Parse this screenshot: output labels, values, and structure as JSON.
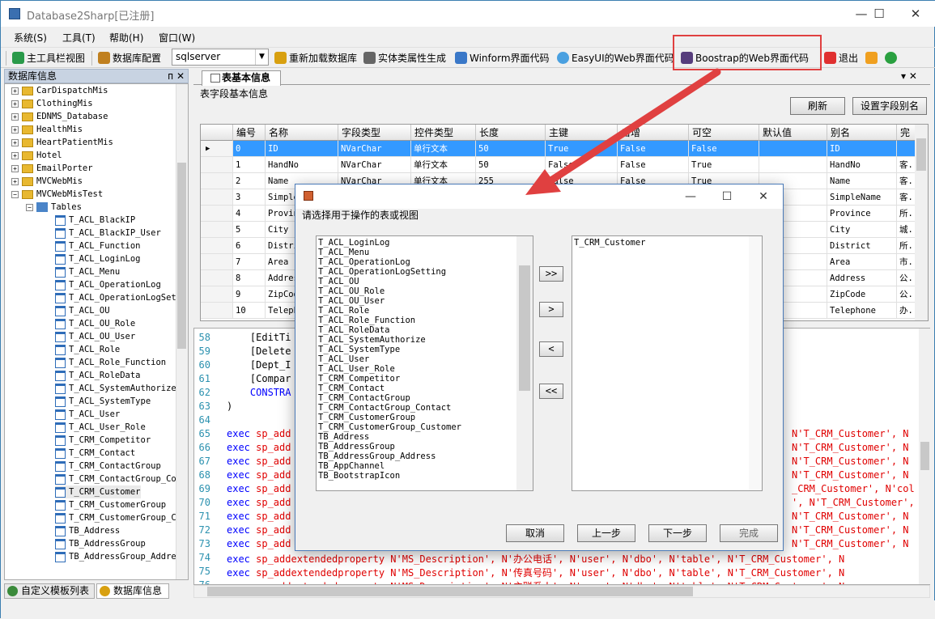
{
  "window": {
    "title": "Database2Sharp[已注册]",
    "min": "—",
    "max": "☐",
    "close": "✕"
  },
  "menu": [
    "系统(S)",
    "工具(T)",
    "帮助(H)",
    "窗口(W)"
  ],
  "toolbar": {
    "main_toolbar": "主工具栏视图",
    "db_config": "数据库配置",
    "db_type": "sqlserver",
    "reload": "重新加载数据库",
    "entity_gen": "实体类属性生成",
    "winform": "Winform界面代码",
    "easyui": "EasyUI的Web界面代码",
    "bootstrap": "Boostrap的Web界面代码",
    "exit": "退出"
  },
  "left_panel": {
    "title": "数据库信息",
    "pin": "ᴨ",
    "close": "✕",
    "databases": [
      "CarDispatchMis",
      "ClothingMis",
      "EDNMS_Database",
      "HealthMis",
      "HeartPatientMis",
      "Hotel",
      "EmailPorter",
      "MVCWebMis",
      "MVCWebMisTest"
    ],
    "tables_node": "Tables",
    "tables": [
      "T_ACL_BlackIP",
      "T_ACL_BlackIP_User",
      "T_ACL_Function",
      "T_ACL_LoginLog",
      "T_ACL_Menu",
      "T_ACL_OperationLog",
      "T_ACL_OperationLogSet",
      "T_ACL_OU",
      "T_ACL_OU_Role",
      "T_ACL_OU_User",
      "T_ACL_Role",
      "T_ACL_Role_Function",
      "T_ACL_RoleData",
      "T_ACL_SystemAuthorize",
      "T_ACL_SystemType",
      "T_ACL_User",
      "T_ACL_User_Role",
      "T_CRM_Competitor",
      "T_CRM_Contact",
      "T_CRM_ContactGroup",
      "T_CRM_ContactGroup_Co",
      "T_CRM_Customer",
      "T_CRM_CustomerGroup",
      "T_CRM_CustomerGroup_C",
      "TB_Address",
      "TB_AddressGroup",
      "TB_AddressGroup_Addre"
    ],
    "tabs": [
      "自定义模板列表",
      "数据库信息"
    ]
  },
  "doc_tab": {
    "title": "表基本信息",
    "controls": "▾ ✕"
  },
  "fields_panel": {
    "label": "表字段基本信息",
    "refresh": "刷新",
    "set_alias": "设置字段别名",
    "columns": [
      "编号",
      "名称",
      "字段类型",
      "控件类型",
      "长度",
      "主键",
      "自增",
      "可空",
      "默认值",
      "别名",
      "完"
    ],
    "rows": [
      [
        "0",
        "ID",
        "NVarChar",
        "单行文本",
        "50",
        "True",
        "False",
        "False",
        "",
        "ID",
        ""
      ],
      [
        "1",
        "HandNo",
        "NVarChar",
        "单行文本",
        "50",
        "False",
        "False",
        "True",
        "",
        "HandNo",
        "客."
      ],
      [
        "2",
        "Name",
        "NVarChar",
        "单行文本",
        "255",
        "False",
        "False",
        "True",
        "",
        "Name",
        "客."
      ],
      [
        "3",
        "SimpleName",
        "",
        "",
        "",
        "",
        "",
        "",
        "",
        "SimpleName",
        "客."
      ],
      [
        "4",
        "Province",
        "",
        "",
        "",
        "",
        "",
        "",
        "",
        "Province",
        "所."
      ],
      [
        "5",
        "City",
        "",
        "",
        "",
        "",
        "",
        "",
        "",
        "City",
        "城."
      ],
      [
        "6",
        "District",
        "",
        "",
        "",
        "",
        "",
        "",
        "",
        "District",
        "所."
      ],
      [
        "7",
        "Area",
        "",
        "",
        "",
        "",
        "",
        "",
        "",
        "Area",
        "市."
      ],
      [
        "8",
        "Address",
        "",
        "",
        "",
        "",
        "",
        "",
        "",
        "Address",
        "公."
      ],
      [
        "9",
        "ZipCode",
        "",
        "",
        "",
        "",
        "",
        "",
        "",
        "ZipCode",
        "公."
      ],
      [
        "10",
        "Telephone",
        "",
        "",
        "",
        "",
        "",
        "",
        "",
        "Telephone",
        "办."
      ]
    ]
  },
  "code_lines": [
    {
      "n": "58",
      "t": "    [EditTi",
      "s": ""
    },
    {
      "n": "59",
      "t": "    [Delete",
      "s": ""
    },
    {
      "n": "60",
      "t": "    [Dept_I",
      "s": ""
    },
    {
      "n": "61",
      "t": "    [Compar",
      "s": ""
    },
    {
      "n": "62",
      "t": "    CONSTRA",
      "s": "kw"
    },
    {
      "n": "63",
      "t": ")",
      "s": ""
    },
    {
      "n": "64",
      "t": "",
      "s": ""
    },
    {
      "n": "65",
      "t": "exec sp_add",
      "r": "N'T_CRM_Customer', N"
    },
    {
      "n": "66",
      "t": "exec sp_add",
      "r": "N'T_CRM_Customer', N"
    },
    {
      "n": "67",
      "t": "exec sp_add",
      "r": "N'T_CRM_Customer', N"
    },
    {
      "n": "68",
      "t": "exec sp_add",
      "r": "N'T_CRM_Customer', N"
    },
    {
      "n": "69",
      "t": "exec sp_add",
      "r": "_CRM_Customer', N'col"
    },
    {
      "n": "70",
      "t": "exec sp_add",
      "r": "', N'T_CRM_Customer',"
    },
    {
      "n": "71",
      "t": "exec sp_add",
      "r": "N'T_CRM_Customer', N"
    },
    {
      "n": "72",
      "t": "exec sp_add",
      "r": "N'T_CRM_Customer', N"
    },
    {
      "n": "73",
      "t": "exec sp_add",
      "r": "N'T_CRM_Customer', N"
    },
    {
      "n": "74",
      "t": "exec sp_addextendedproperty N'MS_Description', N'办公电话', N'user', N'dbo', N'table', N'T_CRM_Customer', N"
    },
    {
      "n": "75",
      "t": "exec sp_addextendedproperty N'MS_Description', N'传真号码', N'user', N'dbo', N'table', N'T_CRM_Customer', N"
    },
    {
      "n": "76",
      "t": "exec sp_addextendedproperty N'MS_Description', N'主联系人', N'user', N'dbo', N'table', N'T_CRM_Customer', N"
    }
  ],
  "dialog": {
    "title_min": "—",
    "title_max": "☐",
    "title_close": "✕",
    "label": "请选择用于操作的表或视图",
    "left_items": [
      "T_ACL_LoginLog",
      "T_ACL_Menu",
      "T_ACL_OperationLog",
      "T_ACL_OperationLogSetting",
      "T_ACL_OU",
      "T_ACL_OU_Role",
      "T_ACL_OU_User",
      "T_ACL_Role",
      "T_ACL_Role_Function",
      "T_ACL_RoleData",
      "T_ACL_SystemAuthorize",
      "T_ACL_SystemType",
      "T_ACL_User",
      "T_ACL_User_Role",
      "T_CRM_Competitor",
      "T_CRM_Contact",
      "T_CRM_ContactGroup",
      "T_CRM_ContactGroup_Contact",
      "T_CRM_CustomerGroup",
      "T_CRM_CustomerGroup_Customer",
      "TB_Address",
      "TB_AddressGroup",
      "TB_AddressGroup_Address",
      "TB_AppChannel",
      "TB_BootstrapIcon"
    ],
    "right_items": [
      "T_CRM_Customer"
    ],
    "move_all_right": ">>",
    "move_right": ">",
    "move_left": "<",
    "move_all_left": "<<",
    "cancel": "取消",
    "prev": "上一步",
    "next": "下一步",
    "finish": "完成"
  },
  "colors": {
    "accent": "#3399ff",
    "highlight_box": "#e04040",
    "arrow": "#e04040"
  }
}
